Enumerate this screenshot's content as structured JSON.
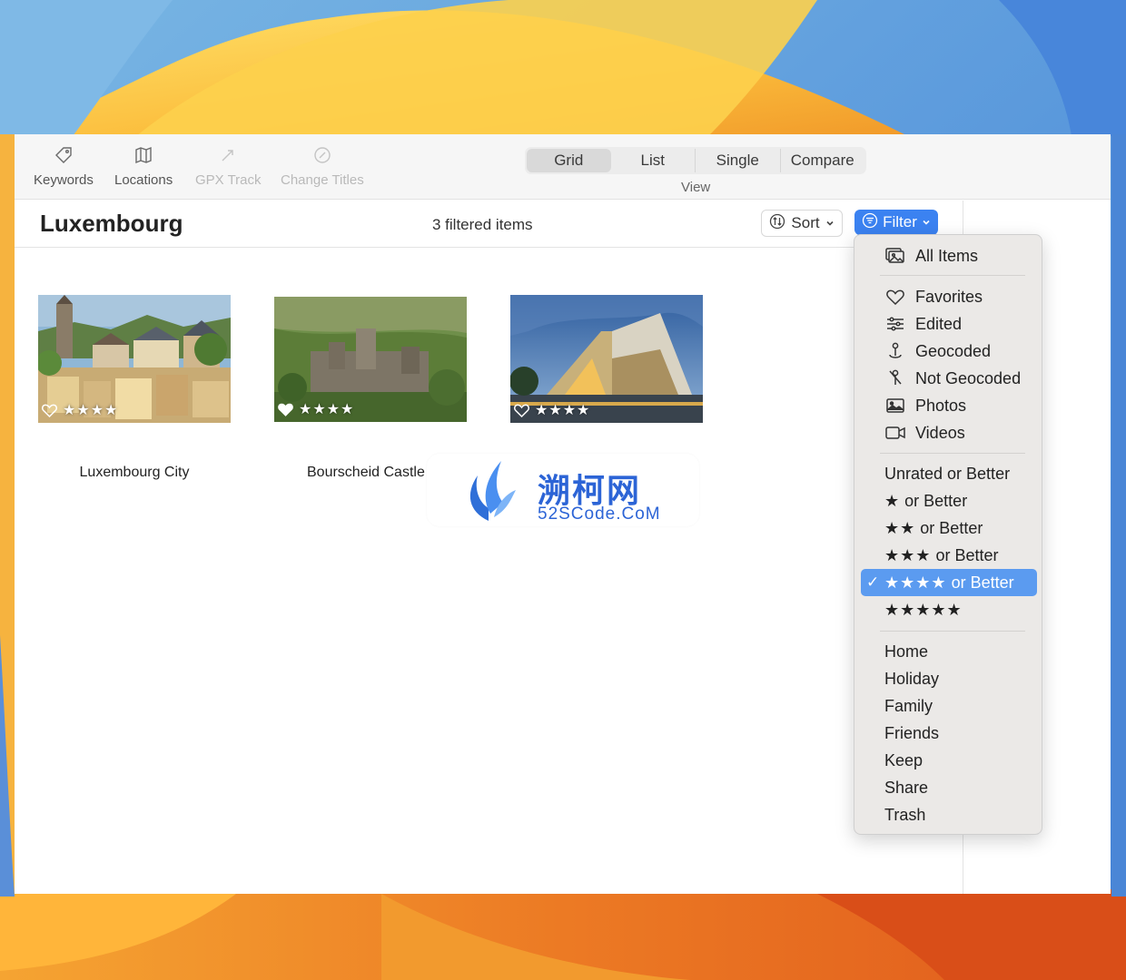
{
  "toolbar": {
    "tools": [
      {
        "label": "Keywords",
        "icon": "tag-icon",
        "enabled": true
      },
      {
        "label": "Locations",
        "icon": "map-icon",
        "enabled": true
      },
      {
        "label": "GPX Track",
        "icon": "pin-arrow-icon",
        "enabled": false
      },
      {
        "label": "Change Titles",
        "icon": "slash-circle-icon",
        "enabled": false
      }
    ],
    "view_modes": [
      "Grid",
      "List",
      "Single",
      "Compare"
    ],
    "active_view": "Grid",
    "view_caption": "View"
  },
  "header": {
    "title": "Luxembourg",
    "count": "3 filtered items",
    "sort_label": "Sort",
    "filter_label": "Filter"
  },
  "photos": [
    {
      "caption": "Luxembourg City",
      "favorite": false,
      "rating": "★★★★"
    },
    {
      "caption": "Bourscheid Castle",
      "favorite": true,
      "rating": "★★★★"
    },
    {
      "caption": "",
      "favorite": false,
      "rating": "★★★★"
    }
  ],
  "watermark": {
    "cn": "溯柯网",
    "en": "52SCode.CoM"
  },
  "filter_menu": {
    "items": [
      {
        "label": "All Items",
        "icon": "photo-stack-icon"
      },
      {
        "label": "Favorites",
        "icon": "heart-icon"
      },
      {
        "label": "Edited",
        "icon": "sliders-icon"
      },
      {
        "label": "Geocoded",
        "icon": "pin-icon"
      },
      {
        "label": "Not Geocoded",
        "icon": "pin-slash-icon"
      },
      {
        "label": "Photos",
        "icon": "photo-icon"
      },
      {
        "label": "Videos",
        "icon": "video-icon"
      },
      {
        "label": "Unrated or Better"
      },
      {
        "stars": "★",
        "label": "or Better"
      },
      {
        "stars": "★★",
        "label": "or Better"
      },
      {
        "stars": "★★★",
        "label": "or Better"
      },
      {
        "stars": "★★★★",
        "label": "or Better",
        "selected": true,
        "check": "✓"
      },
      {
        "stars": "★★★★★",
        "label": ""
      },
      {
        "label": "Home"
      },
      {
        "label": "Holiday"
      },
      {
        "label": "Family"
      },
      {
        "label": "Friends"
      },
      {
        "label": "Keep"
      },
      {
        "label": "Share"
      },
      {
        "label": "Trash"
      }
    ]
  },
  "colors": {
    "accent": "#3b82f1",
    "selected_menu": "#5b9bf0"
  }
}
